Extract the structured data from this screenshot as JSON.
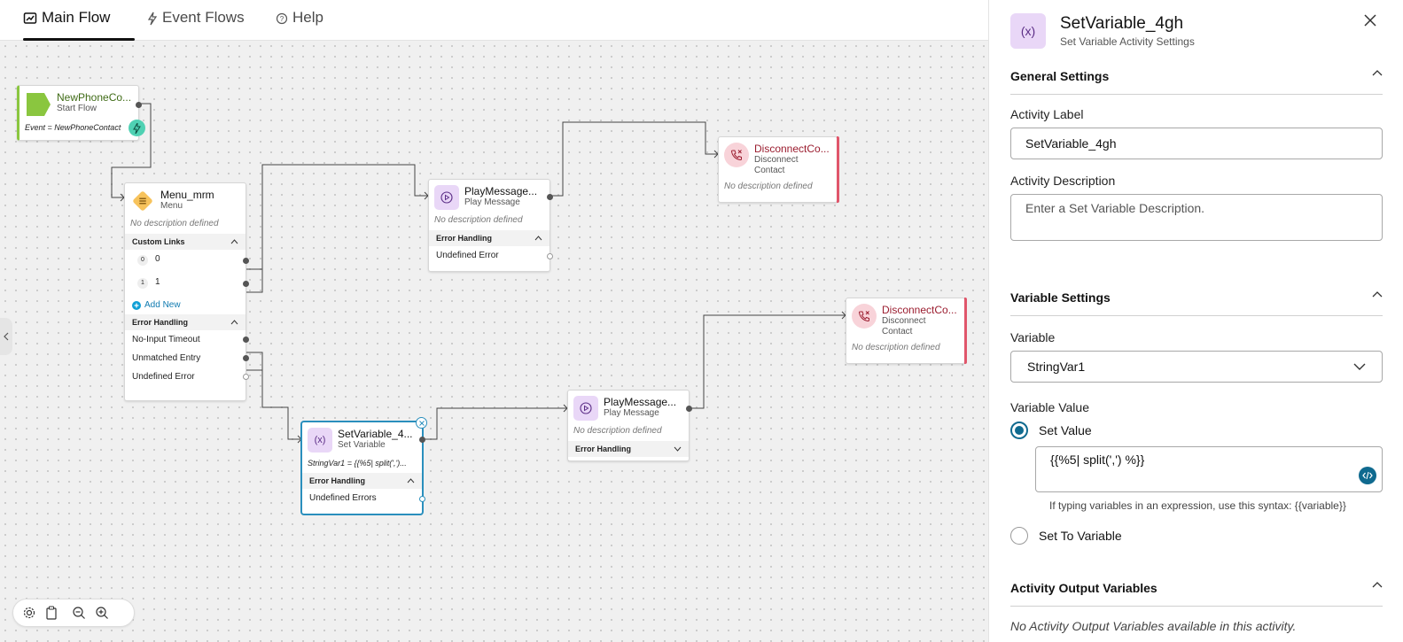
{
  "tabs": [
    {
      "label": "Main Flow",
      "icon": "chart-icon"
    },
    {
      "label": "Event Flows",
      "icon": "bolt-icon"
    },
    {
      "label": "Help",
      "icon": "help-circle-icon"
    }
  ],
  "nodes": {
    "start": {
      "title": "NewPhoneCo...",
      "type": "Start Flow",
      "event": "Event = NewPhoneContact",
      "accent": "#8ac63f"
    },
    "menu": {
      "title": "Menu_mrm",
      "type": "Menu",
      "desc": "No description defined",
      "custom_links_label": "Custom Links",
      "links": [
        {
          "badge": "0",
          "label": "0"
        },
        {
          "badge": "1",
          "label": "1"
        }
      ],
      "add_new": "Add New",
      "error_label": "Error Handling",
      "errors": [
        "No-Input Timeout",
        "Unmatched Entry",
        "Undefined Error"
      ]
    },
    "play1": {
      "title": "PlayMessage...",
      "type": "Play Message",
      "desc": "No description defined",
      "error_label": "Error Handling",
      "errors": [
        "Undefined Error"
      ]
    },
    "disc1": {
      "title": "DisconnectCo...",
      "type_line1": "Disconnect",
      "type_line2": "Contact",
      "desc": "No description defined"
    },
    "disc2": {
      "title": "DisconnectCo...",
      "type_line1": "Disconnect",
      "type_line2": "Contact",
      "desc": "No description defined"
    },
    "setvar": {
      "title": "SetVariable_4...",
      "type": "Set Variable",
      "expr": "StringVar1 = {{%5| split(',')...",
      "error_label": "Error Handling",
      "errors": [
        "Undefined Errors"
      ]
    },
    "play2": {
      "title": "PlayMessage...",
      "type": "Play Message",
      "desc": "No description defined",
      "error_label": "Error Handling"
    }
  },
  "panel": {
    "title": "SetVariable_4gh",
    "subtitle": "Set Variable Activity Settings",
    "general_header": "General Settings",
    "activity_label_label": "Activity Label",
    "activity_label_value": "SetVariable_4gh",
    "activity_desc_label": "Activity Description",
    "activity_desc_placeholder": "Enter a Set Variable Description.",
    "variable_settings_header": "Variable Settings",
    "variable_label": "Variable",
    "variable_value": "StringVar1",
    "variable_value_label": "Variable Value",
    "option_set_value": "Set Value",
    "option_set_to_variable": "Set To Variable",
    "expression": "{{%5| split(',') %}}",
    "expr_hint": "If typing variables in an expression, use this syntax: {{variable}}",
    "output_header": "Activity Output Variables",
    "output_none": "No Activity Output Variables available in this activity."
  },
  "colors": {
    "accent_teal": "#0f6a8f",
    "disconnect_red": "#e0566b",
    "setvar_purple": "#e9d7f7",
    "menu_orange": "#f7c35c"
  }
}
